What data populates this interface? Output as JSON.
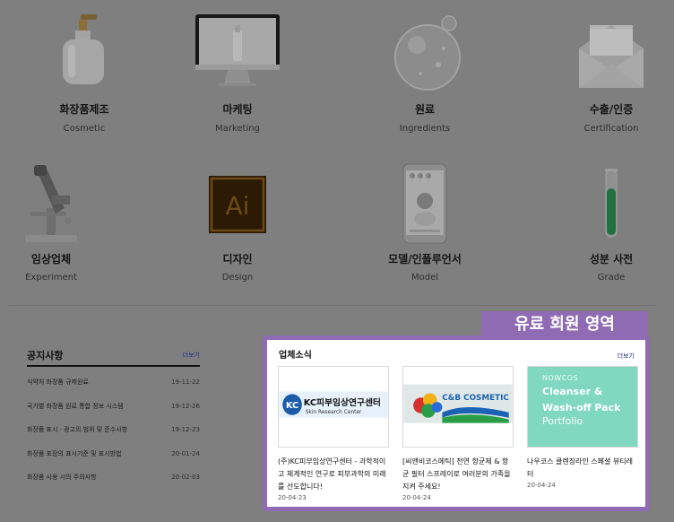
{
  "categories": [
    {
      "title": "화장품제조",
      "sub": "Cosmetic",
      "icon": "pump-bottle-icon"
    },
    {
      "title": "마케팅",
      "sub": "Marketing",
      "icon": "monitor-icon"
    },
    {
      "title": "원료",
      "sub": "Ingredients",
      "icon": "bubble-icon"
    },
    {
      "title": "수출/인증",
      "sub": "Certification",
      "icon": "envelope-icon"
    },
    {
      "title": "임상업체",
      "sub": "Experiment",
      "icon": "microscope-icon"
    },
    {
      "title": "디자인",
      "sub": "Design",
      "icon": "illustrator-icon"
    },
    {
      "title": "모델/인플루언서",
      "sub": "Model",
      "icon": "phone-icon"
    },
    {
      "title": "성분 사전",
      "sub": "Grade",
      "icon": "test-tube-icon"
    }
  ],
  "notice": {
    "title": "공지사항",
    "more": "더보기",
    "items": [
      {
        "text": "식약처 화장품 규제원료",
        "date": "19-11-22"
      },
      {
        "text": "국가별 화장품 원료 통합 정보 시스템",
        "date": "19-12-26"
      },
      {
        "text": "화장품 표시 · 광고의 범위 및 준수사항",
        "date": "19-12-23"
      },
      {
        "text": "화장품 포장의 표시기준 및 표시방법",
        "date": "20-01-24"
      },
      {
        "text": "화장품 사용 시의 주의사항",
        "date": "20-02-03"
      }
    ]
  },
  "paid": {
    "badge": "유료 회원 영역",
    "title": "업체소식",
    "more": "더보기",
    "news": [
      {
        "logo_main": "KC피부임상연구센터",
        "logo_sub": "Skin Research Center",
        "caption": "(주)KC피부임상연구센터 - 과학적이고 체계적인 연구로 피부과학의 미래를 선도합니다!",
        "date": "20-04-23"
      },
      {
        "logo_main": "C&B COSMETIC",
        "caption": "[씨앤비코스메틱] 천연 항균제 & 항균 필터 스프레이로 여러분의 가족을 지켜 주세요!",
        "date": "20-04-24"
      },
      {
        "logo_brand": "NOWCOS",
        "logo_line1": "Cleanser &",
        "logo_line2": "Wash-off Pack",
        "logo_line3": "Portfolio",
        "caption": "나우코스 클렌징라인 스페셜 뷰티레터",
        "date": "20-04-24"
      }
    ]
  },
  "colors": {
    "overlay": "#7f7f7f",
    "accent": "#8e6bb3",
    "link": "#1d2f86",
    "nowcos": "#7fd8bf"
  }
}
